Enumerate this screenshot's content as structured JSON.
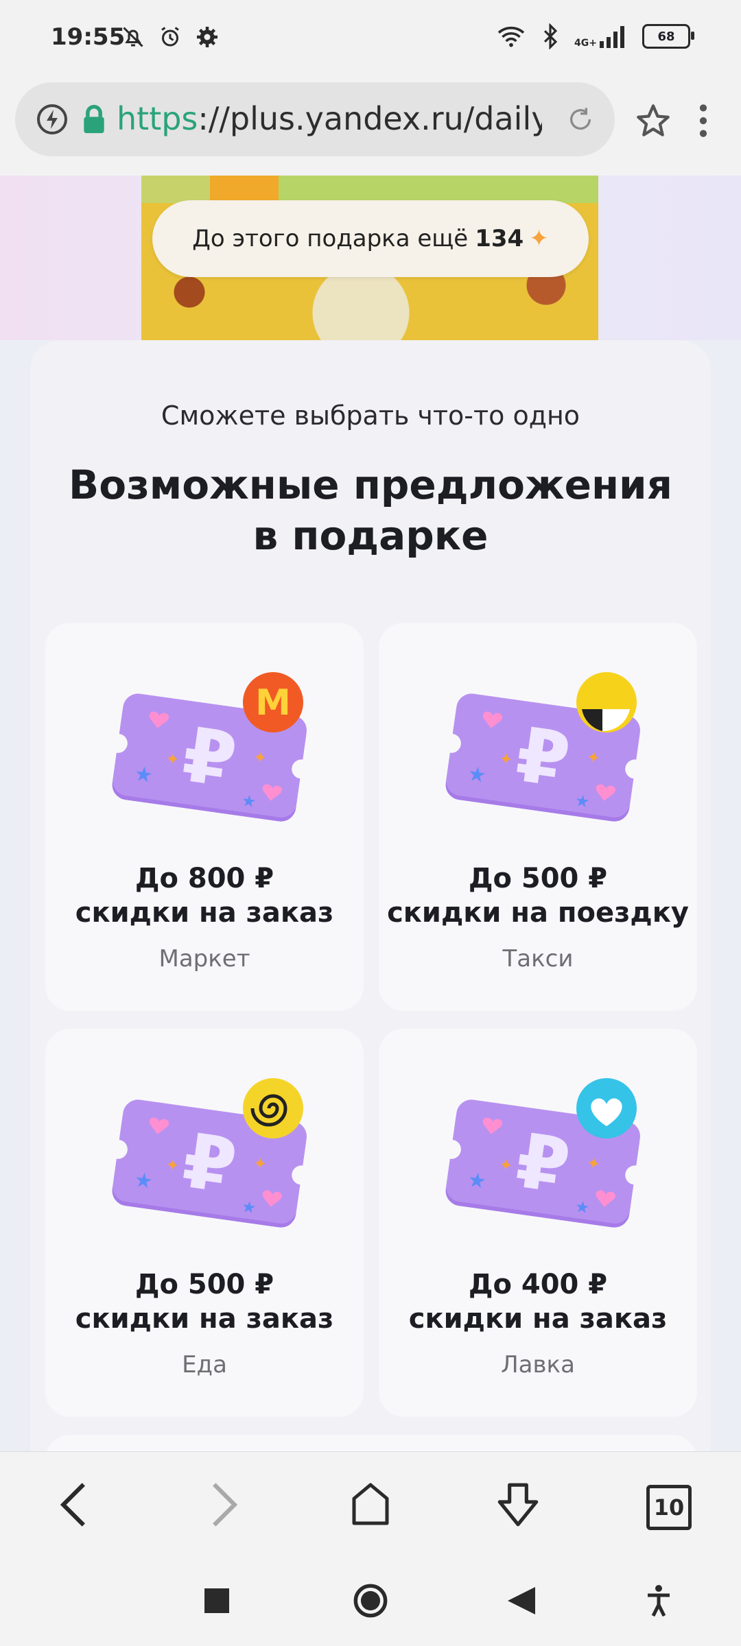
{
  "status_bar": {
    "time": "19:55",
    "network": "4G+",
    "battery": "68",
    "icons": [
      "mute-bell-icon",
      "alarm-icon",
      "gear-icon",
      "wifi-icon",
      "bluetooth-icon",
      "signal-icon",
      "battery-icon"
    ]
  },
  "address_bar": {
    "url_scheme": "https",
    "url_rest": "://plus.yandex.ru/daily?u",
    "icons": [
      "bolt-icon",
      "lock-icon",
      "reload-icon",
      "star-icon",
      "kebab-menu-icon"
    ]
  },
  "hero": {
    "pill_text": "До этого подарка ещё",
    "pill_amount": "134",
    "pill_icon": "plus-spark-icon"
  },
  "main": {
    "subtitle": "Сможете выбрать что-то одно",
    "headline_line1": "Возможные предложения",
    "headline_line2": "в подарке",
    "cards": [
      {
        "title_line1": "До 800 ₽",
        "title_line2": "скидки на заказ",
        "service": "Маркет",
        "badge": "market-logo"
      },
      {
        "title_line1": "До 500 ₽",
        "title_line2": "скидки на поездку",
        "service": "Такси",
        "badge": "taxi-logo"
      },
      {
        "title_line1": "До 500 ₽",
        "title_line2": "скидки на заказ",
        "service": "Еда",
        "badge": "eda-logo"
      },
      {
        "title_line1": "До 400 ₽",
        "title_line2": "скидки на заказ",
        "service": "Лавка",
        "badge": "lavka-logo"
      }
    ]
  },
  "bottom_toolbar": {
    "tab_count": "10",
    "icons": [
      "back-icon",
      "forward-icon",
      "home-icon",
      "download-icon",
      "tabs-icon"
    ]
  },
  "android_nav": {
    "icons": [
      "recents-icon",
      "home-circle-icon",
      "back-triangle-icon",
      "accessibility-icon"
    ]
  },
  "colors": {
    "accent_green": "#2aa37a",
    "coupon_purple": "#a67be8",
    "market_badge": "#f15a24",
    "taxi_badge": "#f7d21b",
    "eda_badge": "#f5d429",
    "lavka_badge": "#35c3e8"
  }
}
